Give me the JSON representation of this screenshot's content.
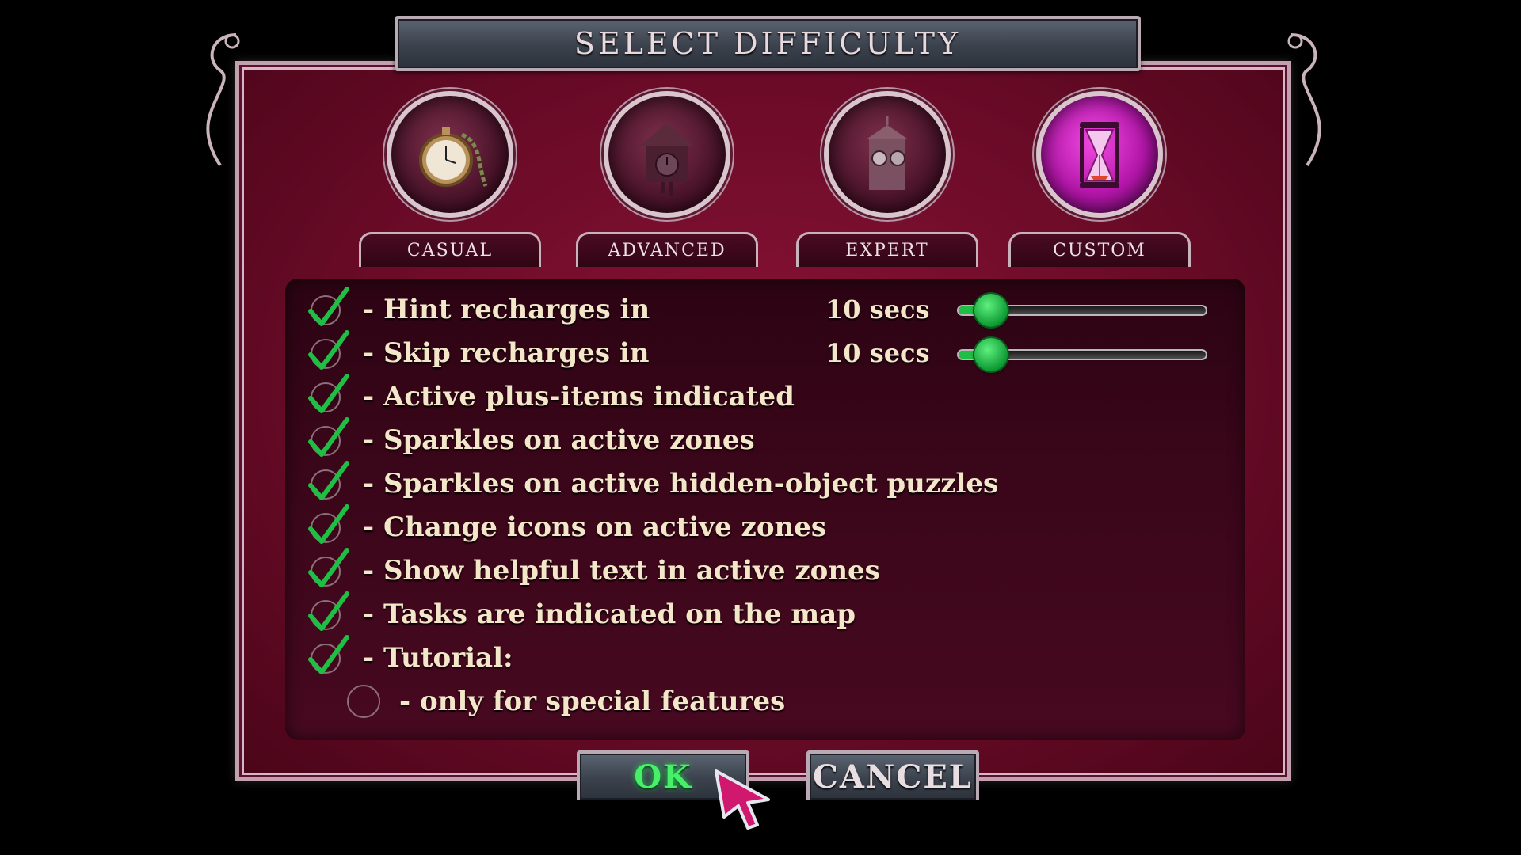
{
  "dialog": {
    "title": "SELECT DIFFICULTY"
  },
  "modes": [
    {
      "label": "CASUAL",
      "icon": "pocket-watch-icon",
      "selected": false
    },
    {
      "label": "ADVANCED",
      "icon": "cuckoo-clock-icon",
      "selected": false
    },
    {
      "label": "EXPERT",
      "icon": "clock-tower-icon",
      "selected": false
    },
    {
      "label": "CUSTOM",
      "icon": "hourglass-icon",
      "selected": true
    }
  ],
  "options": [
    {
      "label": "- Hint recharges in",
      "checked": true,
      "value": "10 secs",
      "slider_fraction": 0.13
    },
    {
      "label": "- Skip recharges in",
      "checked": true,
      "value": "10 secs",
      "slider_fraction": 0.13
    },
    {
      "label": "- Active plus-items indicated",
      "checked": true
    },
    {
      "label": "- Sparkles on active zones",
      "checked": true
    },
    {
      "label": "- Sparkles on active hidden-object puzzles",
      "checked": true
    },
    {
      "label": "- Change icons on active zones",
      "checked": true
    },
    {
      "label": "- Show helpful text in active zones",
      "checked": true
    },
    {
      "label": "- Tasks are indicated on the map",
      "checked": true
    },
    {
      "label": "- Tutorial:",
      "checked": true
    }
  ],
  "tutorial_suboption": {
    "label": "- only for special features",
    "selected": false
  },
  "buttons": {
    "ok": "OK",
    "cancel": "CANCEL"
  },
  "colors": {
    "panel": "#6b0b28",
    "check": "#1fbf45",
    "text": "#f3e6c9",
    "selected_mode": "#d320c8"
  }
}
